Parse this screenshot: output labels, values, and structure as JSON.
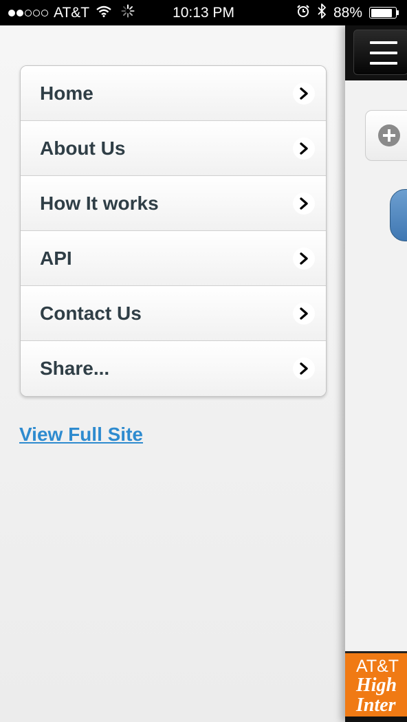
{
  "status_bar": {
    "signal_bars": 2,
    "signal_total": 5,
    "carrier": "AT&T",
    "time": "10:13 PM",
    "battery_percent": "88%",
    "battery_level": 0.88
  },
  "menu": {
    "items": [
      {
        "label": "Home"
      },
      {
        "label": "About Us"
      },
      {
        "label": "How It works"
      },
      {
        "label": "API"
      },
      {
        "label": "Contact Us"
      },
      {
        "label": "Share..."
      }
    ],
    "view_full_site": "View Full Site"
  },
  "main": {
    "ad": {
      "line1": "AT&T",
      "line2": "High",
      "line3": "Inter"
    }
  },
  "colors": {
    "link": "#2e8bcf",
    "menu_text": "#2f3e46",
    "ad_orange": "#f07a14",
    "blue_button": "#4a82bd"
  },
  "icons": [
    "wifi-icon",
    "activity-spinner-icon",
    "alarm-icon",
    "bluetooth-icon",
    "battery-icon",
    "chevron-right-icon",
    "hamburger-icon",
    "plus-circle-icon"
  ]
}
